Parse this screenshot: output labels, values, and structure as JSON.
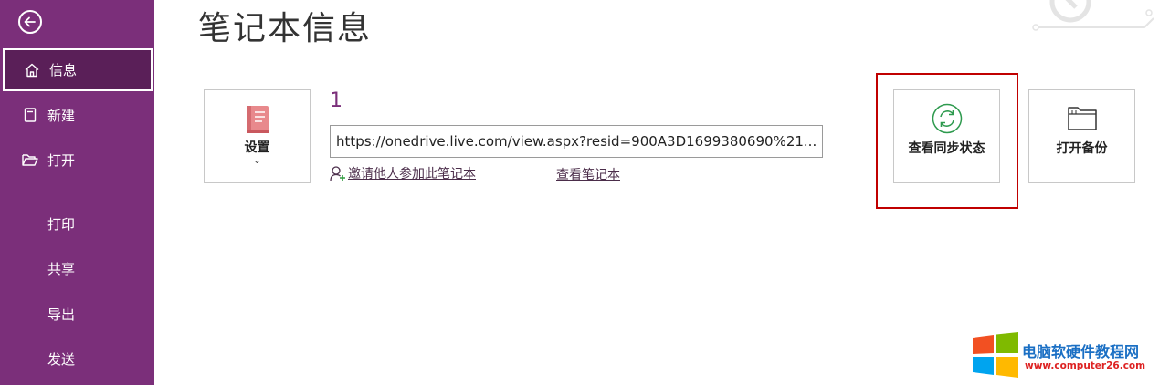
{
  "sidebar": {
    "active_item": "信息",
    "items": [
      {
        "label": "信息",
        "icon": "home-icon"
      },
      {
        "label": "新建",
        "icon": "new-page-icon"
      },
      {
        "label": "打开",
        "icon": "folder-open-icon"
      },
      {
        "label": "打印"
      },
      {
        "label": "共享"
      },
      {
        "label": "导出"
      },
      {
        "label": "发送"
      }
    ],
    "accent_color": "#7b2f7a"
  },
  "main": {
    "title": "笔记本信息",
    "settings_tile": {
      "label": "设置",
      "chevron": "⌄"
    },
    "notebook": {
      "name": "1",
      "url": "https://onedrive.live.com/view.aspx?resid=900A3D1699380690%21...",
      "invite_link": "邀请他人参加此笔记本",
      "view_link": "查看笔记本"
    },
    "actions": [
      {
        "label": "查看同步状态",
        "icon": "sync-icon",
        "highlighted": true
      },
      {
        "label": "打开备份",
        "icon": "folder-icon"
      }
    ]
  },
  "watermark": {
    "title": "电脑软硬件教程网",
    "url": "www.computer26.com"
  }
}
